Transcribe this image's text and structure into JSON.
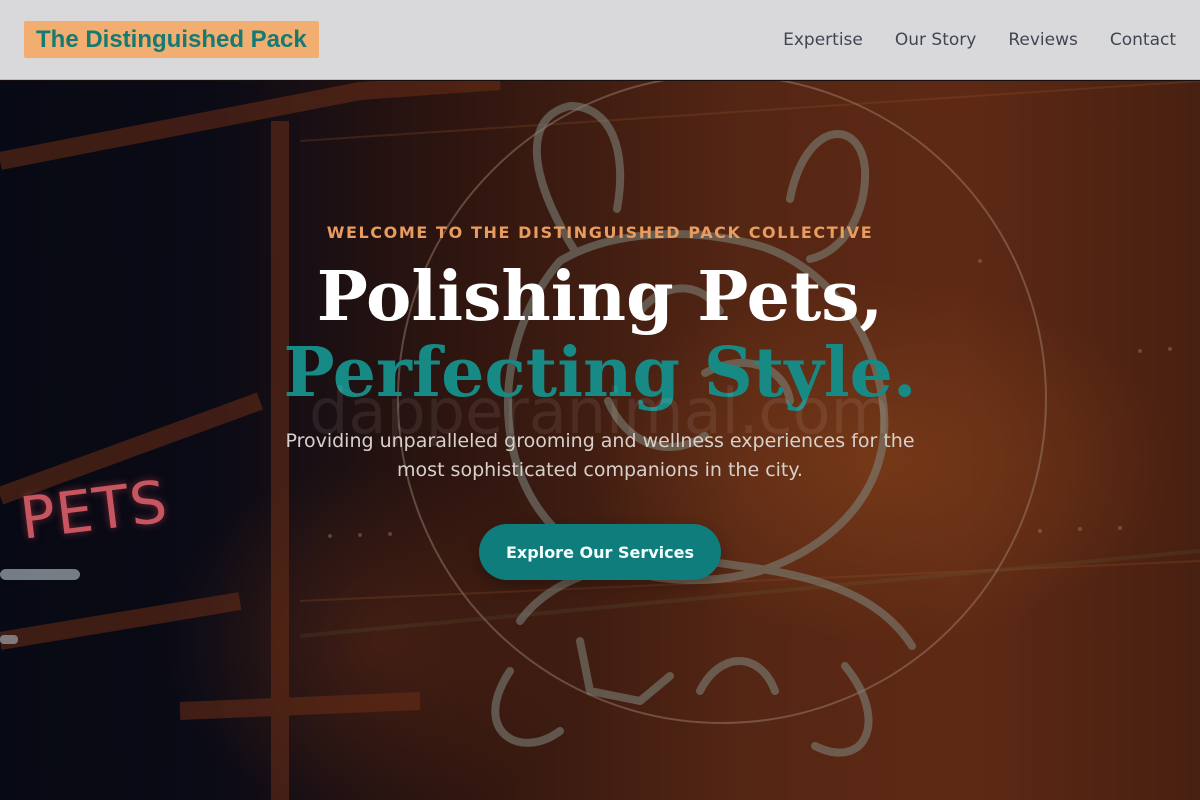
{
  "header": {
    "logo": "The Distinguished Pack",
    "nav": [
      "Expertise",
      "Our Story",
      "Reviews",
      "Contact"
    ]
  },
  "hero": {
    "eyebrow": "WELCOME TO THE DISTINGUISHED PACK COLLECTIVE",
    "title_main": "Polishing Pets,",
    "title_accent": "Perfecting Style.",
    "watermark": "dapperanimal.com",
    "subtitle": "Providing unparalleled grooming and wellness experiences for the most sophisticated companions in the city.",
    "cta": "Explore Our Services",
    "sign_text": "PETS"
  },
  "colors": {
    "logo_bg": "#f2ad71",
    "logo_text": "#157a73",
    "accent": "#178a86",
    "eyebrow": "#e99c60",
    "button": "#0f7d7c"
  }
}
